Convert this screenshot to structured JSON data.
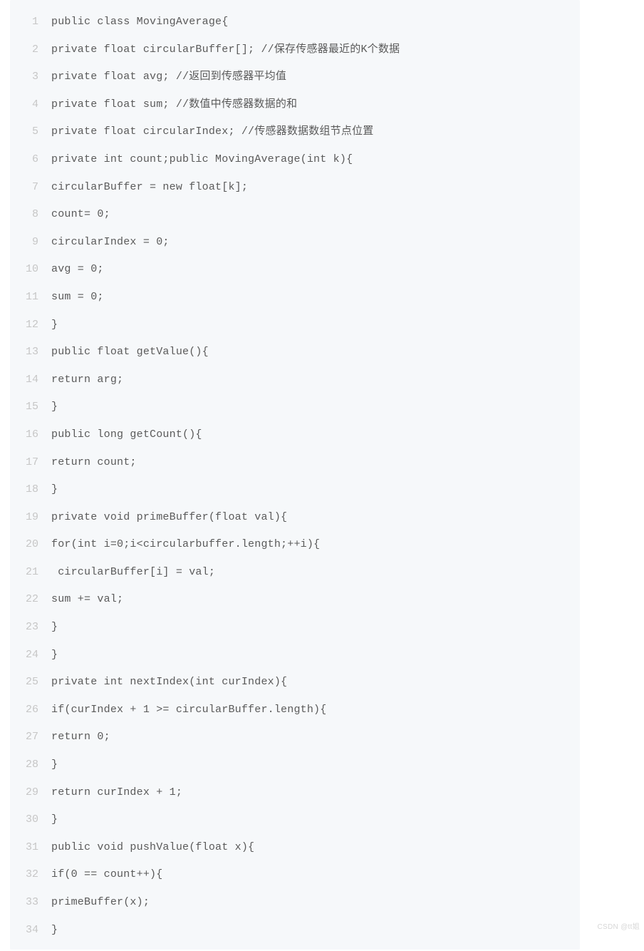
{
  "watermark": "CSDN @tt姐",
  "code": {
    "lines": [
      {
        "n": "1",
        "t": "public class MovingAverage{"
      },
      {
        "n": "2",
        "t": "private float circularBuffer[]; //保存传感器最近的K个数据"
      },
      {
        "n": "3",
        "t": "private float avg; //返回到传感器平均值"
      },
      {
        "n": "4",
        "t": "private float sum; //数值中传感器数据的和"
      },
      {
        "n": "5",
        "t": "private float circularIndex; //传感器数据数组节点位置"
      },
      {
        "n": "6",
        "t": "private int count;public MovingAverage(int k){"
      },
      {
        "n": "7",
        "t": "circularBuffer = new float[k];"
      },
      {
        "n": "8",
        "t": "count= 0;"
      },
      {
        "n": "9",
        "t": "circularIndex = 0;"
      },
      {
        "n": "10",
        "t": "avg = 0;"
      },
      {
        "n": "11",
        "t": "sum = 0;"
      },
      {
        "n": "12",
        "t": "}"
      },
      {
        "n": "13",
        "t": "public float getValue(){"
      },
      {
        "n": "14",
        "t": "return arg;"
      },
      {
        "n": "15",
        "t": "}"
      },
      {
        "n": "16",
        "t": "public long getCount(){"
      },
      {
        "n": "17",
        "t": "return count;"
      },
      {
        "n": "18",
        "t": "}"
      },
      {
        "n": "19",
        "t": "private void primeBuffer(float val){"
      },
      {
        "n": "20",
        "t": "for(int i=0;i<circularbuffer.length;++i){"
      },
      {
        "n": "21",
        "t": " circularBuffer[i] = val;"
      },
      {
        "n": "22",
        "t": "sum += val;"
      },
      {
        "n": "23",
        "t": "}"
      },
      {
        "n": "24",
        "t": "}"
      },
      {
        "n": "25",
        "t": "private int nextIndex(int curIndex){"
      },
      {
        "n": "26",
        "t": "if(curIndex + 1 >= circularBuffer.length){"
      },
      {
        "n": "27",
        "t": "return 0;"
      },
      {
        "n": "28",
        "t": "}"
      },
      {
        "n": "29",
        "t": "return curIndex + 1;"
      },
      {
        "n": "30",
        "t": "}"
      },
      {
        "n": "31",
        "t": "public void pushValue(float x){"
      },
      {
        "n": "32",
        "t": "if(0 == count++){"
      },
      {
        "n": "33",
        "t": "primeBuffer(x);"
      },
      {
        "n": "34",
        "t": "}"
      }
    ]
  }
}
